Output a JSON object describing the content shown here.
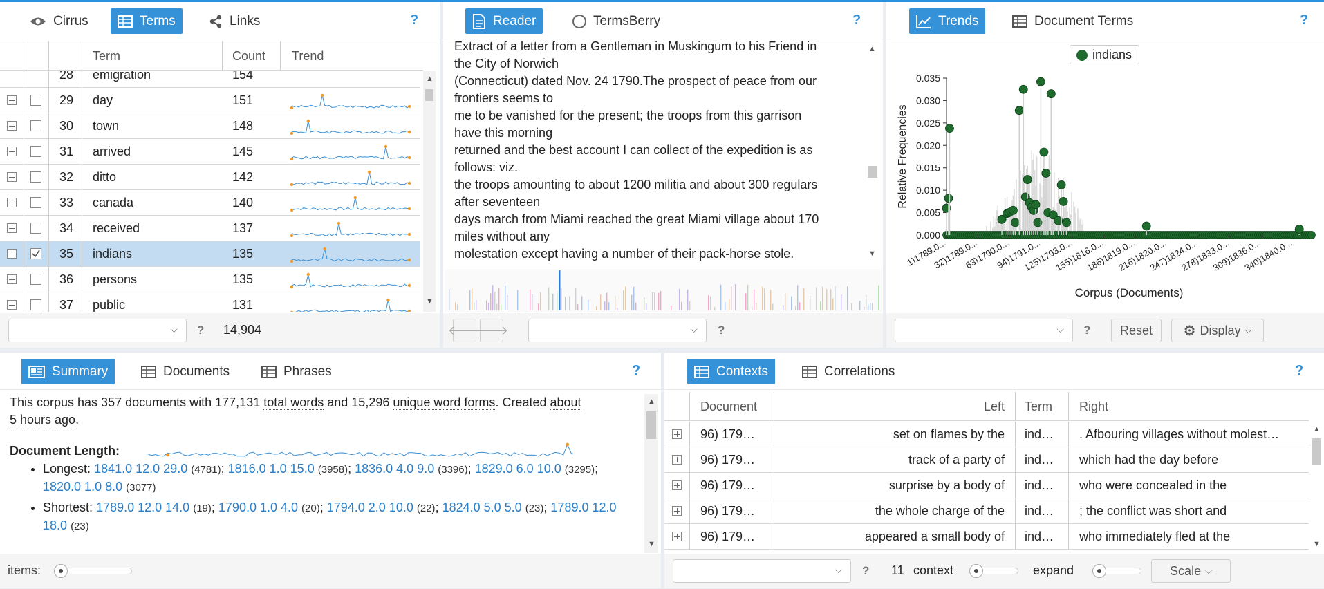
{
  "accent": "#3592d8",
  "terms_panel": {
    "tabs": [
      {
        "label": "Cirrus",
        "icon": "eye-icon"
      },
      {
        "label": "Terms",
        "icon": "table-icon"
      },
      {
        "label": "Links",
        "icon": "share-icon"
      }
    ],
    "help": "?",
    "columns": [
      "Term",
      "Count",
      "Trend"
    ],
    "partial_row": {
      "num": "28",
      "term": "emigration",
      "count": "154"
    },
    "rows": [
      {
        "num": "29",
        "term": "day",
        "count": "151",
        "checked": false,
        "selected": false
      },
      {
        "num": "30",
        "term": "town",
        "count": "148",
        "checked": false,
        "selected": false
      },
      {
        "num": "31",
        "term": "arrived",
        "count": "145",
        "checked": false,
        "selected": false
      },
      {
        "num": "32",
        "term": "ditto",
        "count": "142",
        "checked": false,
        "selected": false
      },
      {
        "num": "33",
        "term": "canada",
        "count": "140",
        "checked": false,
        "selected": false
      },
      {
        "num": "34",
        "term": "received",
        "count": "137",
        "checked": false,
        "selected": false
      },
      {
        "num": "35",
        "term": "indians",
        "count": "135",
        "checked": true,
        "selected": true
      },
      {
        "num": "36",
        "term": "persons",
        "count": "135",
        "checked": false,
        "selected": false
      },
      {
        "num": "37",
        "term": "public",
        "count": "131",
        "checked": false,
        "selected": false
      }
    ],
    "footer_total": "14,904",
    "footer_help": "?"
  },
  "reader_panel": {
    "tabs": [
      {
        "label": "Reader",
        "icon": "document-icon"
      },
      {
        "label": "TermsBerry",
        "icon": "radio-icon"
      }
    ],
    "help": "?",
    "lines": [
      "Extract of a letter from a Gentleman in Muskingum to his Friend in",
      "the City of Norwich",
      "(Connecticut) dated Nov. 24 1790.The prospect of peace from our",
      "frontiers seems to",
      "me to be vanished for the present; the troops from this garrison",
      "have this morning",
      "returned and the best account I can collect of the expedition is as",
      "follows: viz.",
      "the troops amounting to about 1200 militia and about 300 regulars",
      "after seventeen",
      "days march from Miami reached the great Miami village about 170",
      "miles without any",
      "molestation except having a number of their pack-horse stole."
    ],
    "footer_help": "?"
  },
  "trends_panel": {
    "tabs": [
      {
        "label": "Trends",
        "icon": "line-chart-icon"
      },
      {
        "label": "Document Terms",
        "icon": "table-icon"
      }
    ],
    "help": "?",
    "legend": "indians",
    "reset_label": "Reset",
    "display_label": "Display",
    "footer_help": "?"
  },
  "chart_data": {
    "type": "scatter",
    "title": "",
    "legend": [
      "indians"
    ],
    "series_color": "#1e6b2d",
    "xlabel": "Corpus (Documents)",
    "ylabel": "Relative Frequencies",
    "ylim": [
      0,
      0.035
    ],
    "yticks": [
      "0.000",
      "0.005",
      "0.010",
      "0.015",
      "0.020",
      "0.025",
      "0.030",
      "0.035"
    ],
    "xticks": [
      "1)1789.0...",
      "32)1789.0...",
      "63)1790.0...",
      "94)1791.0...",
      "125)1793.0...",
      "155)1816.0...",
      "186)1819.0...",
      "216)1820.0...",
      "247)1824.0...",
      "278)1833.0...",
      "309)1836.0...",
      "340)1840.0..."
    ],
    "xlim": [
      1,
      357
    ],
    "points": [
      [
        1,
        0.006
      ],
      [
        3,
        0.0082
      ],
      [
        4,
        0.0238
      ],
      [
        55,
        0.0035
      ],
      [
        60,
        0.0048
      ],
      [
        62,
        0.005
      ],
      [
        64,
        0.0052
      ],
      [
        66,
        0.0055
      ],
      [
        68,
        0.0028
      ],
      [
        72,
        0.0278
      ],
      [
        76,
        0.0325
      ],
      [
        78,
        0.0085
      ],
      [
        80,
        0.0124
      ],
      [
        82,
        0.0072
      ],
      [
        84,
        0.0062
      ],
      [
        86,
        0.0055
      ],
      [
        88,
        0.0068
      ],
      [
        90,
        0.0028
      ],
      [
        93,
        0.0342
      ],
      [
        96,
        0.0185
      ],
      [
        98,
        0.0138
      ],
      [
        100,
        0.005
      ],
      [
        103,
        0.0315
      ],
      [
        105,
        0.0045
      ],
      [
        110,
        0.0032
      ],
      [
        113,
        0.0112
      ],
      [
        115,
        0.0075
      ],
      [
        118,
        0.0028
      ],
      [
        196,
        0.002
      ],
      [
        345,
        0.0013
      ]
    ]
  },
  "summary_panel": {
    "tabs": [
      {
        "label": "Summary",
        "icon": "summary-icon"
      },
      {
        "label": "Documents",
        "icon": "table-icon"
      },
      {
        "label": "Phrases",
        "icon": "table-icon"
      }
    ],
    "help": "?",
    "intro_parts": {
      "a": "This corpus has 357 documents with 177,131 ",
      "b": "total words",
      "c": " and 15,296 ",
      "d": "unique word forms",
      "e": ". Created ",
      "f": "about",
      "g": "5 hours ago",
      "h": "."
    },
    "doc_length_label": "Document Length:",
    "longest_label": "Longest:",
    "longest": [
      {
        "doc": "1841.0 12.0 29.0",
        "n": "(4781)"
      },
      {
        "doc": "1816.0 1.0 15.0",
        "n": "(3958)"
      },
      {
        "doc": "1836.0 4.0 9.0",
        "n": "(3396)"
      },
      {
        "doc": "1829.0 6.0 10.0",
        "n": "(3295)"
      },
      {
        "doc": "1820.0 1.0 8.0",
        "n": "(3077)"
      }
    ],
    "shortest_label": "Shortest:",
    "shortest": [
      {
        "doc": "1789.0 12.0 14.0",
        "n": "(19)"
      },
      {
        "doc": "1790.0 1.0 4.0",
        "n": "(20)"
      },
      {
        "doc": "1794.0 2.0 10.0",
        "n": "(22)"
      },
      {
        "doc": "1824.0 5.0 5.0",
        "n": "(23)"
      },
      {
        "doc": "1789.0 12.0 18.0",
        "n": "(23)"
      }
    ],
    "items_label": "items:"
  },
  "contexts_panel": {
    "tabs": [
      {
        "label": "Contexts",
        "icon": "table-icon"
      },
      {
        "label": "Correlations",
        "icon": "table-icon"
      }
    ],
    "help": "?",
    "columns": [
      "Document",
      "Left",
      "Term",
      "Right"
    ],
    "rows": [
      {
        "doc": "96) 179…",
        "left": "set on flames by the",
        "term": "ind…",
        "right": ". Afbouring villages without molest…"
      },
      {
        "doc": "96) 179…",
        "left": "track of a party of",
        "term": "ind…",
        "right": "which had the day before"
      },
      {
        "doc": "96) 179…",
        "left": "surprise by a body of",
        "term": "ind…",
        "right": "who were concealed in the"
      },
      {
        "doc": "96) 179…",
        "left": "the whole charge of the",
        "term": "ind…",
        "right": "; the conflict was short and"
      },
      {
        "doc": "96) 179…",
        "left": "appeared a small body of",
        "term": "ind…",
        "right": "who immediately fled at the"
      }
    ],
    "footer_help": "?",
    "context_count": "11",
    "context_label": "context",
    "expand_label": "expand",
    "scale_label": "Scale"
  }
}
